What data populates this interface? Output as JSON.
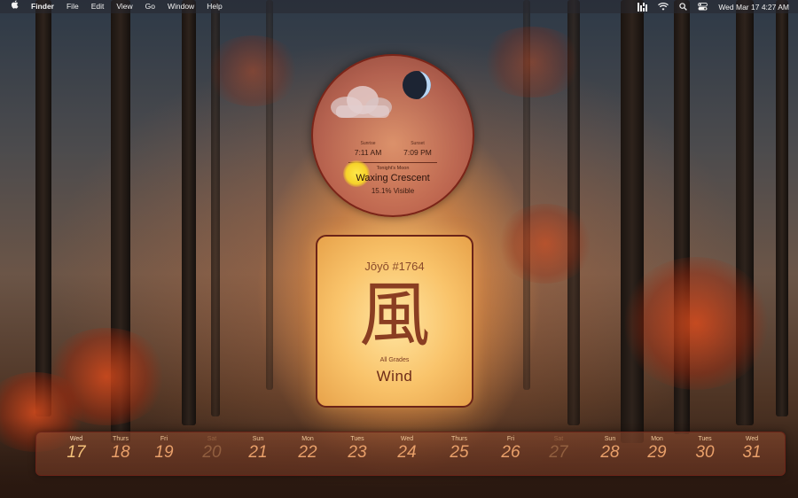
{
  "menubar": {
    "apple_icon": "apple-logo-icon",
    "app_name": "Finder",
    "menus": [
      "File",
      "Edit",
      "View",
      "Go",
      "Window",
      "Help"
    ],
    "status_icons": [
      "widget-icon",
      "wifi-icon",
      "search-icon",
      "control-center-icon"
    ],
    "clock": "Wed Mar 17  4:27 AM"
  },
  "weather_widget": {
    "sunrise_label": "Sunrise",
    "sunrise_time": "7:11 AM",
    "sunset_label": "Sunset",
    "sunset_time": "7:09 PM",
    "moon_label": "Tonight's Moon",
    "moon_phase": "Waxing Crescent",
    "moon_visible": "15.1% Visible",
    "icons": [
      "cloud-icon",
      "moon-icon",
      "sun-icon"
    ]
  },
  "kanji_widget": {
    "number": "Jōyō #1764",
    "character": "風",
    "grade": "All Grades",
    "meaning": "Wind"
  },
  "calendar": {
    "days": [
      {
        "name": "Wed",
        "num": "17"
      },
      {
        "name": "Thurs",
        "num": "18"
      },
      {
        "name": "Fri",
        "num": "19"
      },
      {
        "name": "Sat",
        "num": "20"
      },
      {
        "name": "Sun",
        "num": "21"
      },
      {
        "name": "Mon",
        "num": "22"
      },
      {
        "name": "Tues",
        "num": "23"
      },
      {
        "name": "Wed",
        "num": "24"
      },
      {
        "name": "Thurs",
        "num": "25"
      },
      {
        "name": "Fri",
        "num": "26"
      },
      {
        "name": "Sat",
        "num": "27"
      },
      {
        "name": "Sun",
        "num": "28"
      },
      {
        "name": "Mon",
        "num": "29"
      },
      {
        "name": "Tues",
        "num": "30"
      },
      {
        "name": "Wed",
        "num": "31"
      }
    ]
  }
}
